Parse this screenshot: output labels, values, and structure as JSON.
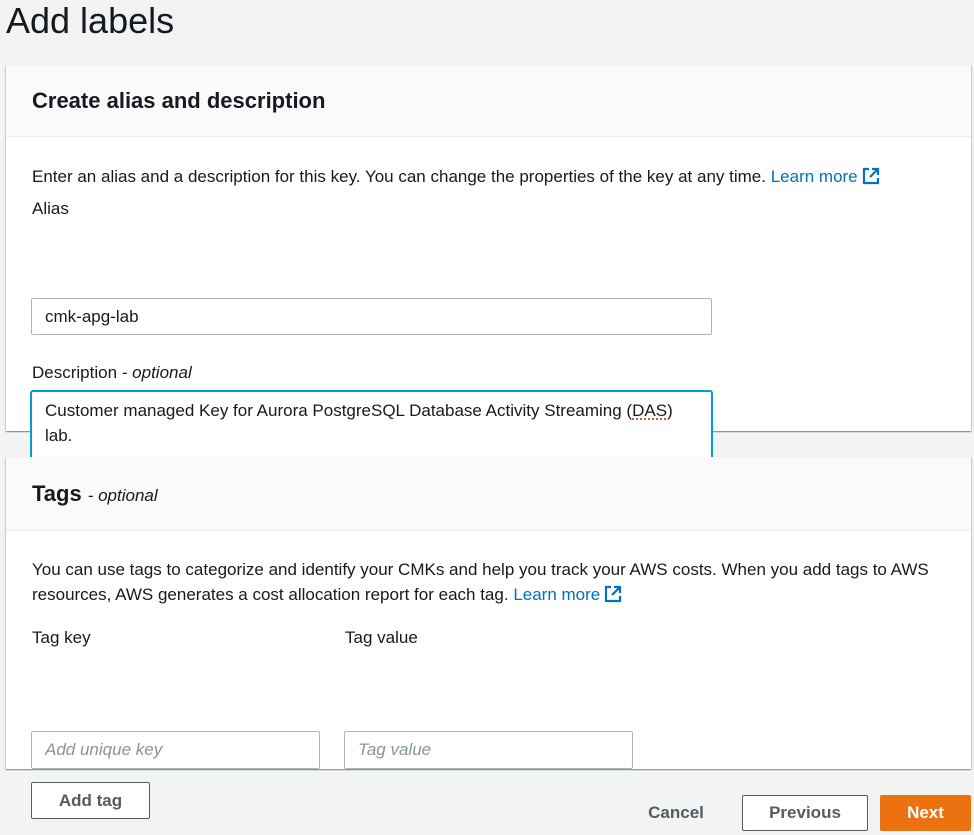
{
  "page": {
    "title": "Add labels"
  },
  "alias_panel": {
    "title": "Create alias and description",
    "intro": "Enter an alias and a description for this key. You can change the properties of the key at any time.",
    "learn_more": "Learn more",
    "alias_label": "Alias",
    "alias_value": "cmk-apg-lab",
    "description_label": "Description",
    "description_optional": "- optional",
    "description_value_pre": "Customer managed Key for Aurora PostgreSQL Database Activity Streaming (",
    "description_value_flag": "DAS",
    "description_value_post": ")",
    "description_value_line2": "lab."
  },
  "tags_panel": {
    "title": "Tags",
    "optional": "- optional",
    "intro": "You can use tags to categorize and identify your CMKs and help you track your AWS costs. When you add tags to AWS resources, AWS generates a cost allocation report for each tag.",
    "learn_more": "Learn more",
    "tag_key_label": "Tag key",
    "tag_key_placeholder": "Add unique key",
    "tag_value_label": "Tag value",
    "tag_value_placeholder": "Tag value",
    "add_tag": "Add tag"
  },
  "footer": {
    "cancel": "Cancel",
    "previous": "Previous",
    "next": "Next"
  },
  "colors": {
    "accent": "#ec7211",
    "link": "#0073bb",
    "focus": "#00a1c9"
  }
}
